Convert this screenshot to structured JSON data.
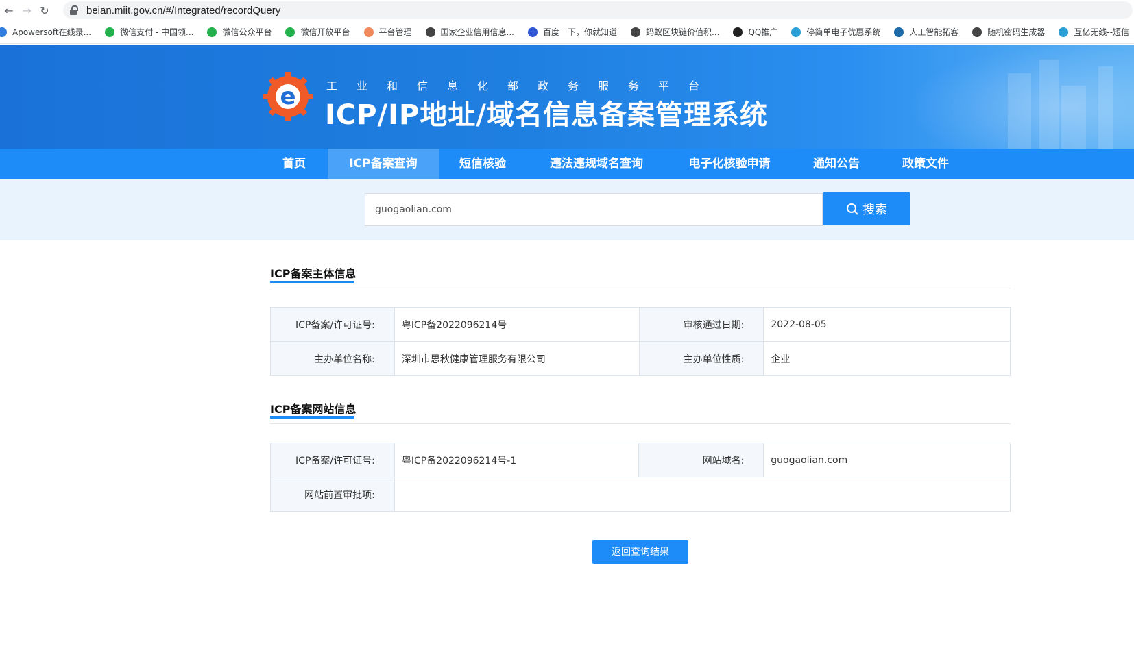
{
  "browser": {
    "url": "beian.miit.gov.cn/#/Integrated/recordQuery",
    "bookmarks": [
      {
        "label": "Apowersoft在线录...",
        "color": "#2f7de1"
      },
      {
        "label": "微信支付 - 中国领...",
        "color": "#22b14c"
      },
      {
        "label": "微信公众平台",
        "color": "#22b14c"
      },
      {
        "label": "微信开放平台",
        "color": "#22b14c"
      },
      {
        "label": "平台管理",
        "color": "#f08a5d"
      },
      {
        "label": "国家企业信用信息...",
        "color": "#444444"
      },
      {
        "label": "百度一下，你就知道",
        "color": "#2f55d4"
      },
      {
        "label": "蚂蚁区块链价值积...",
        "color": "#444444"
      },
      {
        "label": "QQ推广",
        "color": "#222222"
      },
      {
        "label": "停简单电子优惠系统",
        "color": "#2a9fd6"
      },
      {
        "label": "人工智能拓客",
        "color": "#1e6aa8"
      },
      {
        "label": "随机密码生成器",
        "color": "#444444"
      },
      {
        "label": "互亿无线--短信",
        "color": "#2a9fd6"
      }
    ]
  },
  "header": {
    "subtitle": "工业和信息化部政务服务平台",
    "title": "ICP/IP地址/域名信息备案管理系统"
  },
  "nav": {
    "items": [
      {
        "label": "首页",
        "active": false
      },
      {
        "label": "ICP备案查询",
        "active": true
      },
      {
        "label": "短信核验",
        "active": false
      },
      {
        "label": "违法违规域名查询",
        "active": false
      },
      {
        "label": "电子化核验申请",
        "active": false
      },
      {
        "label": "通知公告",
        "active": false
      },
      {
        "label": "政策文件",
        "active": false
      }
    ]
  },
  "search": {
    "value": "guogaolian.com",
    "button_label": "搜索"
  },
  "subject_section": {
    "title": "ICP备案主体信息",
    "rows": [
      {
        "label1": "ICP备案/许可证号:",
        "value1": "粤ICP备2022096214号",
        "label2": "审核通过日期:",
        "value2": "2022-08-05"
      },
      {
        "label1": "主办单位名称:",
        "value1": "深圳市思秋健康管理服务有限公司",
        "label2": "主办单位性质:",
        "value2": "企业"
      }
    ]
  },
  "website_section": {
    "title": "ICP备案网站信息",
    "license_label": "ICP备案/许可证号:",
    "license_value": "粤ICP备2022096214号-1",
    "domain_label": "网站域名:",
    "domain_value": "guogaolian.com",
    "approval_label": "网站前置审批项:",
    "approval_value": ""
  },
  "back_button_label": "返回查询结果",
  "colors": {
    "primary": "#1d8cf8",
    "nav_active": "#4aa3f9",
    "search_band": "#e9f3fd"
  }
}
